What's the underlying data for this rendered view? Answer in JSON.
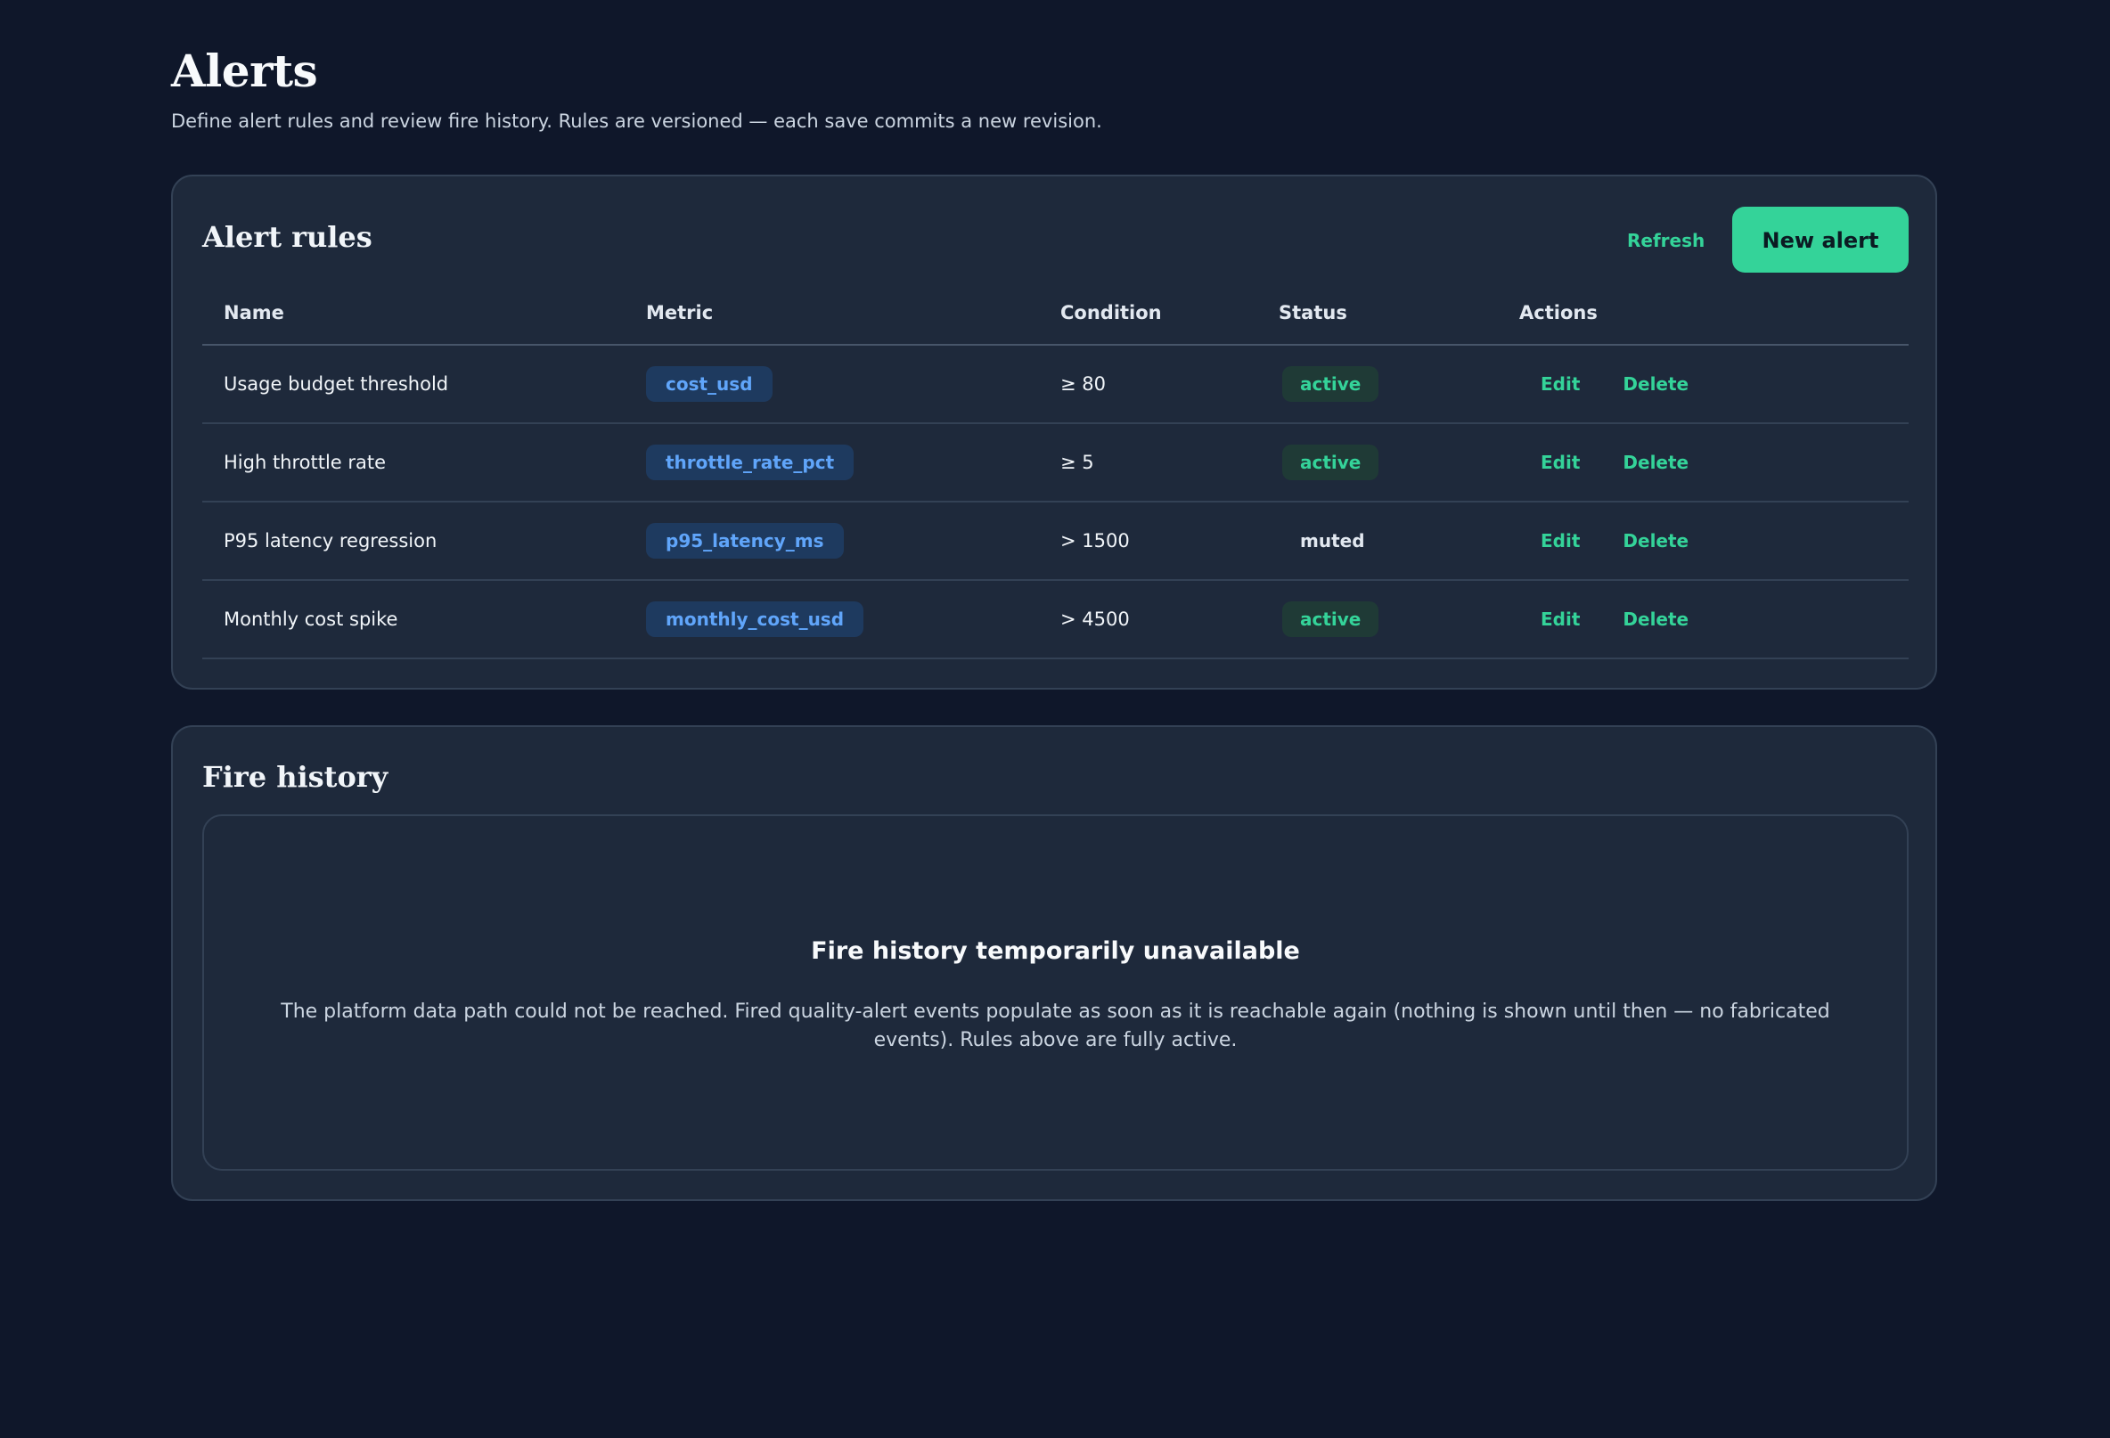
{
  "page": {
    "title": "Alerts",
    "subtitle": "Define alert rules and review fire history. Rules are versioned — each save commits a new revision."
  },
  "rules_card": {
    "title": "Alert rules",
    "refresh_label": "Refresh",
    "new_alert_label": "New alert",
    "columns": [
      "Name",
      "Metric",
      "Condition",
      "Status",
      "Actions"
    ],
    "rows": [
      {
        "name": "Usage budget threshold",
        "metric": "cost_usd",
        "condition": "≥ 80",
        "status": "active",
        "edit": "Edit",
        "delete": "Delete"
      },
      {
        "name": "High throttle rate",
        "metric": "throttle_rate_pct",
        "condition": "≥ 5",
        "status": "active",
        "edit": "Edit",
        "delete": "Delete"
      },
      {
        "name": "P95 latency regression",
        "metric": "p95_latency_ms",
        "condition": "> 1500",
        "status": "muted",
        "edit": "Edit",
        "delete": "Delete"
      },
      {
        "name": "Monthly cost spike",
        "metric": "monthly_cost_usd",
        "condition": "> 4500",
        "status": "active",
        "edit": "Edit",
        "delete": "Delete"
      }
    ]
  },
  "history_card": {
    "title": "Fire history",
    "empty_heading": "Fire history temporarily unavailable",
    "empty_body": "The platform data path could not be reached. Fired quality-alert events populate as soon as it is reachable again (nothing is shown until then — no fabricated events). Rules above are fully active."
  },
  "colors": {
    "background": "#0f172a",
    "card": "#1e293b",
    "accent": "#34d399",
    "metric_chip_text": "#60a5fa"
  }
}
